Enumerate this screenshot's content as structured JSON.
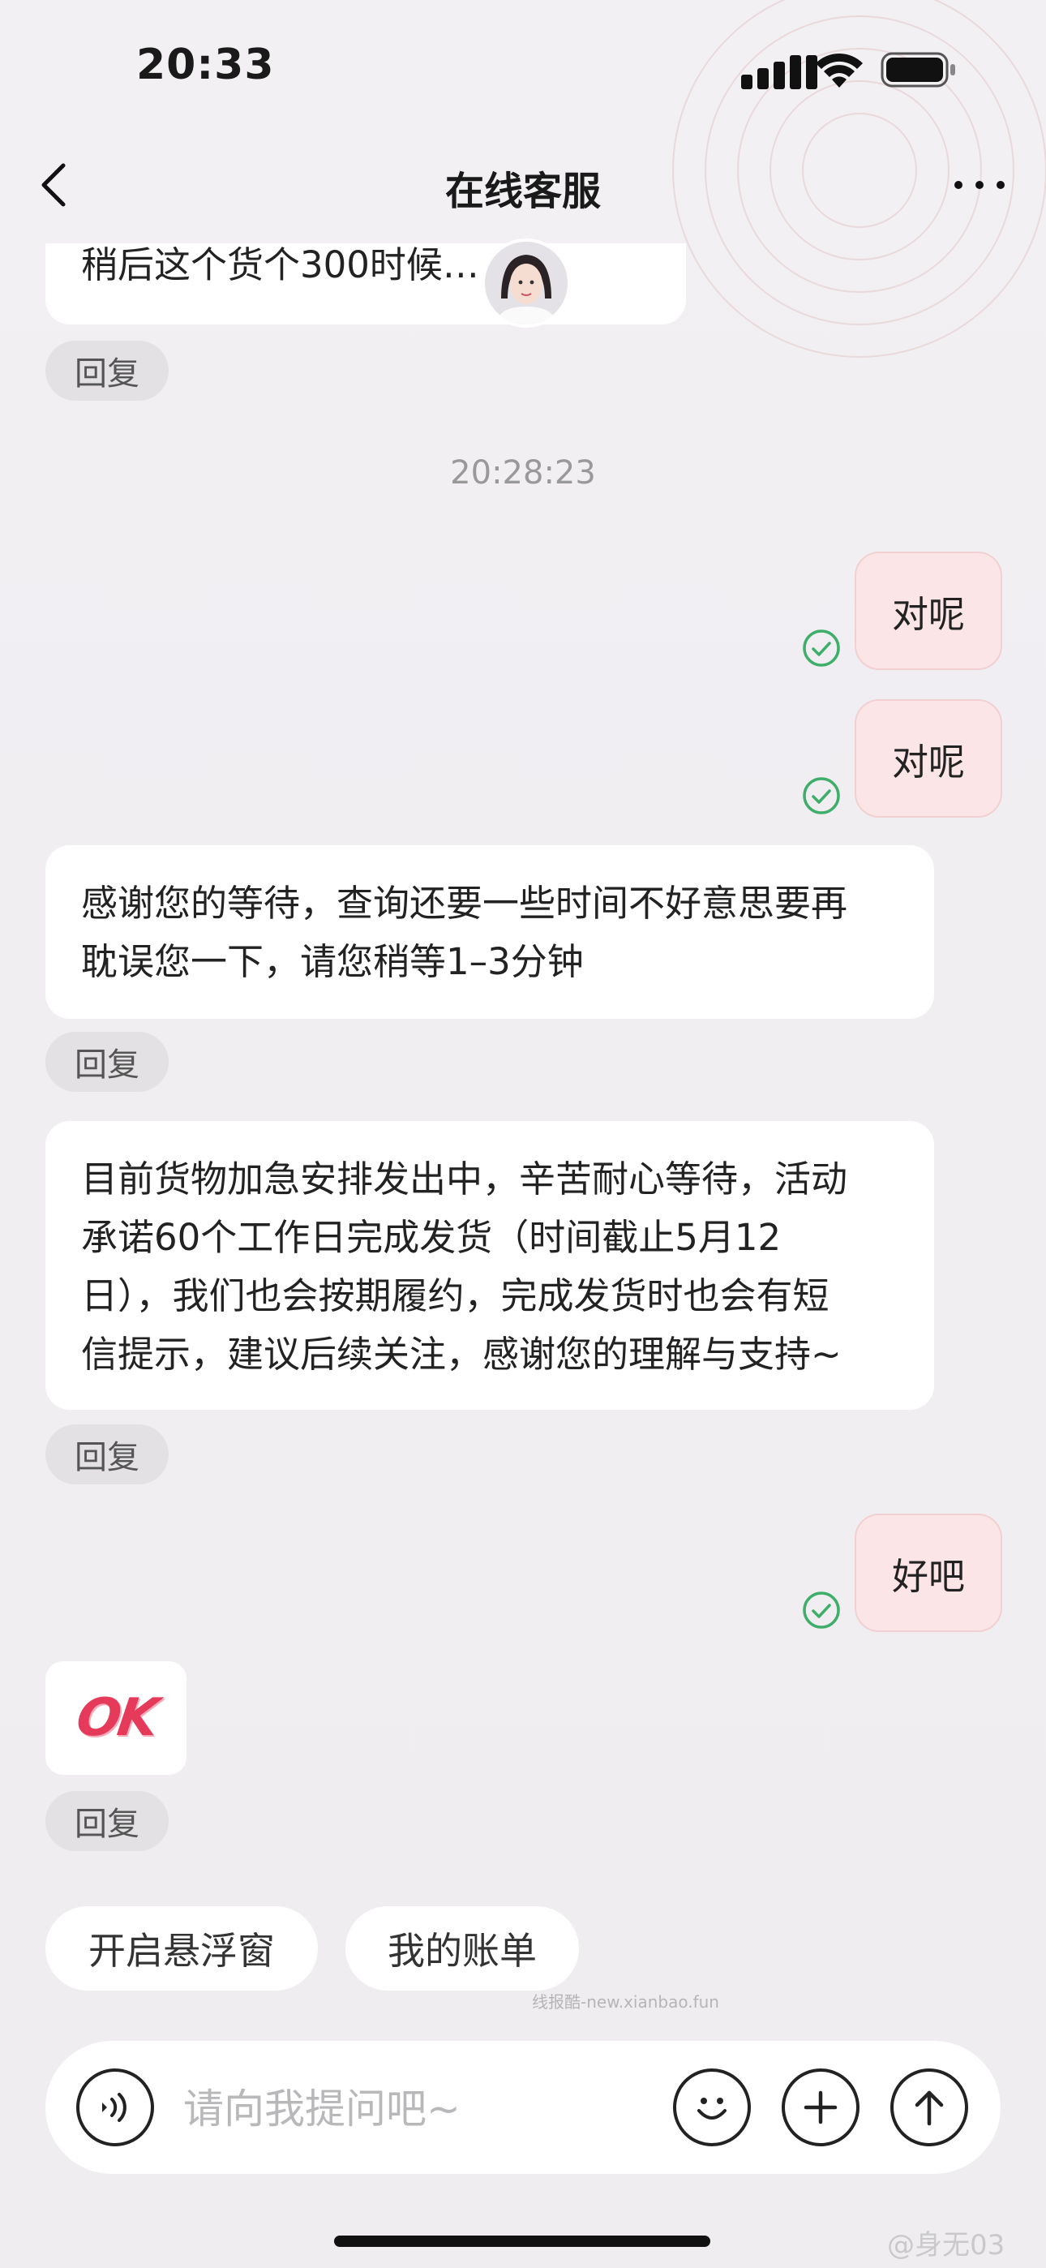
{
  "status_bar": {
    "time": "20:33",
    "icons": [
      "signal-icon",
      "wifi-icon",
      "battery-icon"
    ]
  },
  "nav": {
    "title": "在线客服",
    "back_icon": "chevron-left-icon",
    "more_icon": "more-icon"
  },
  "partial_message": {
    "visible_text": "稍后这个货个300时候……可",
    "reply_label": "回复"
  },
  "timestamp": "20:28:23",
  "messages": [
    {
      "from": "user",
      "text": "对呢",
      "status": "sent"
    },
    {
      "from": "user",
      "text": "对呢",
      "status": "sent"
    },
    {
      "from": "agent",
      "lines": [
        "感谢您的等待，查询还要一些时间不好意思要再",
        "耽误您一下，请您稍等1–3分钟"
      ],
      "reply_label": "回复"
    },
    {
      "from": "agent",
      "lines": [
        "目前货物加急安排发出中，辛苦耐心等待，活动",
        "承诺60个工作日完成发货（时间截止5月12",
        "日），我们也会按期履约，完成发货时也会有短",
        "信提示，建议后续关注，感谢您的理解与支持~"
      ],
      "reply_label": "回复"
    },
    {
      "from": "user",
      "text": "好吧",
      "status": "sent"
    },
    {
      "from": "agent",
      "sticker": "OK",
      "reply_label": "回复"
    }
  ],
  "quick_actions": [
    "开启悬浮窗",
    "我的账单"
  ],
  "watermark": "线报酷-new.xianbao.fun",
  "input": {
    "placeholder": "请向我提问吧~",
    "voice_icon": "voice-icon",
    "emoji_icon": "emoji-icon",
    "plus_icon": "plus-icon",
    "send_icon": "arrow-up-icon"
  },
  "footer_watermark": "@身无03",
  "colors": {
    "user_bubble": "#fbe5e6",
    "check_green": "#3fae6a",
    "sticker_red": "#e53a5a"
  }
}
